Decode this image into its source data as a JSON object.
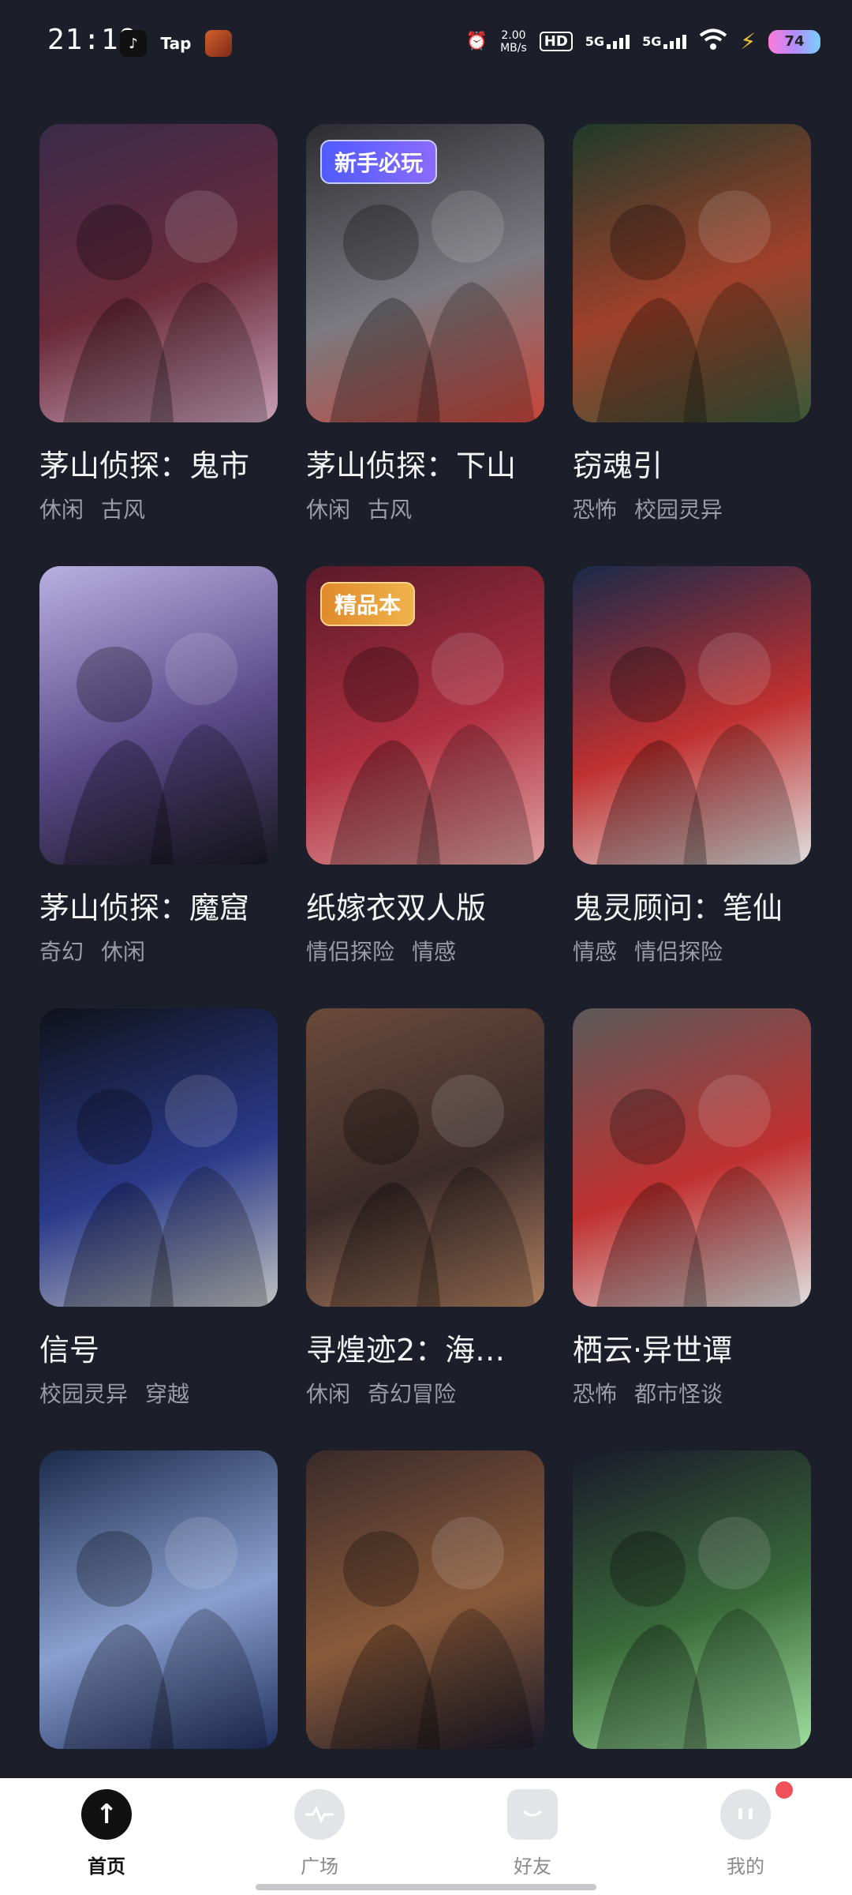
{
  "status_bar": {
    "time": "21:18",
    "apps": [
      "TikTok",
      "Tap",
      "Game"
    ],
    "net_speed_value": "2.00",
    "net_speed_unit": "MB/s",
    "hd": "HD",
    "sim1": "5G",
    "sim2": "5G",
    "battery": "74"
  },
  "cards": [
    {
      "title": "茅山侦探：鬼市",
      "tags": [
        "休闲",
        "古风"
      ],
      "badge": "",
      "colors": [
        "#3a2a4a",
        "#6a2a3a",
        "#c9a1b7"
      ]
    },
    {
      "title": "茅山侦探：下山",
      "tags": [
        "休闲",
        "古风"
      ],
      "badge": "新手必玩",
      "colors": [
        "#2b2b30",
        "#7a7a80",
        "#c9453a"
      ]
    },
    {
      "title": "窃魂引",
      "tags": [
        "恐怖",
        "校园灵异"
      ],
      "badge": "",
      "colors": [
        "#1f3a2a",
        "#a0402a",
        "#3a5a3a"
      ]
    },
    {
      "title": "茅山侦探：魔窟",
      "tags": [
        "奇幻",
        "休闲"
      ],
      "badge": "",
      "colors": [
        "#b8b0e0",
        "#5a4a8a",
        "#1a1a22"
      ]
    },
    {
      "title": "纸嫁衣双人版",
      "tags": [
        "情侣探险",
        "情感"
      ],
      "badge": "精品本",
      "colors": [
        "#5a1a2a",
        "#b03040",
        "#e0a0a0"
      ]
    },
    {
      "title": "鬼灵顾问：笔仙",
      "tags": [
        "情感",
        "情侣探险"
      ],
      "badge": "",
      "colors": [
        "#1a2a4a",
        "#c03030",
        "#e0e0e0"
      ]
    },
    {
      "title": "信号",
      "tags": [
        "校园灵异",
        "穿越"
      ],
      "badge": "",
      "colors": [
        "#10121a",
        "#2a3a8a",
        "#c0c0c0"
      ]
    },
    {
      "title": "寻煌迹2：海…",
      "tags": [
        "休闲",
        "奇幻冒险"
      ],
      "badge": "",
      "colors": [
        "#6a4a3a",
        "#3a2a2a",
        "#b08060"
      ]
    },
    {
      "title": "栖云·异世谭",
      "tags": [
        "恐怖",
        "都市怪谈"
      ],
      "badge": "",
      "colors": [
        "#5a5a5a",
        "#c03030",
        "#e0e0e0"
      ]
    },
    {
      "title": "",
      "tags": [],
      "badge": "",
      "colors": [
        "#1a2a4a",
        "#8aa0d0",
        "#203060"
      ]
    },
    {
      "title": "",
      "tags": [],
      "badge": "",
      "colors": [
        "#3a2a2a",
        "#8a5a3a",
        "#1a1a2a"
      ]
    },
    {
      "title": "",
      "tags": [],
      "badge": "",
      "colors": [
        "#1a1a2a",
        "#3a6a3a",
        "#a0e0a0"
      ]
    }
  ],
  "nav": {
    "home": "首页",
    "square": "广场",
    "friends": "好友",
    "me": "我的"
  }
}
